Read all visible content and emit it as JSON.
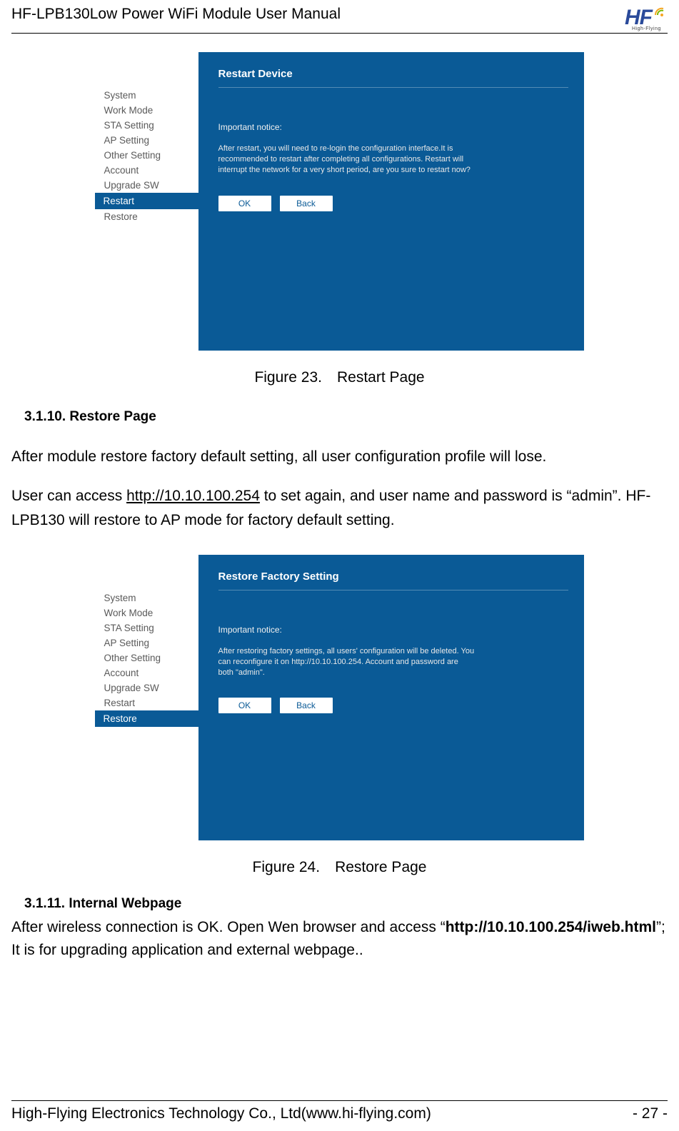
{
  "header": {
    "title": "HF-LPB130Low Power WiFi Module User Manual",
    "logo_text": "HF",
    "logo_sub": "High-Flying"
  },
  "fig23": {
    "sidebar": {
      "items": [
        {
          "label": "System"
        },
        {
          "label": "Work Mode"
        },
        {
          "label": "STA Setting"
        },
        {
          "label": "AP Setting"
        },
        {
          "label": "Other Setting"
        },
        {
          "label": "Account"
        },
        {
          "label": "Upgrade SW"
        },
        {
          "label": "Restart"
        },
        {
          "label": "Restore"
        }
      ],
      "active_index": 7
    },
    "panel": {
      "title": "Restart Device",
      "notice_label": "Important notice:",
      "notice_text": "After restart, you will need to re-login the configuration interface.It is recommended to restart after completing all configurations. Restart will interrupt the network for a very short period, are you sure to restart now?",
      "ok_label": "OK",
      "back_label": "Back"
    },
    "caption": "Figure 23. Restart Page"
  },
  "sec3110": {
    "heading": "3.1.10.  Restore Page",
    "para1": "After module restore factory default setting, all user configuration profile will lose.",
    "para2_pre": "User can access ",
    "para2_link": "http://10.10.100.254",
    "para2_post": " to set again, and user name and password is “admin”. HF-LPB130 will restore to AP mode for factory default setting."
  },
  "fig24": {
    "sidebar": {
      "items": [
        {
          "label": "System"
        },
        {
          "label": "Work Mode"
        },
        {
          "label": "STA Setting"
        },
        {
          "label": "AP Setting"
        },
        {
          "label": "Other Setting"
        },
        {
          "label": "Account"
        },
        {
          "label": "Upgrade SW"
        },
        {
          "label": "Restart"
        },
        {
          "label": "Restore"
        }
      ],
      "active_index": 8
    },
    "panel": {
      "title": "Restore Factory Setting",
      "notice_label": "Important notice:",
      "notice_text": "After restoring factory settings, all users' configuration will be deleted. You can reconfigure it on http://10.10.100.254. Account and password are both \"admin\".",
      "ok_label": "OK",
      "back_label": "Back"
    },
    "caption": "Figure 24. Restore Page"
  },
  "sec3111": {
    "heading": "3.1.11.  Internal Webpage",
    "para_pre": "After wireless connection is OK. Open Wen browser and access “",
    "para_bold": "http://10.10.100.254/iweb.html",
    "para_post": "”; It is for upgrading application and external webpage.."
  },
  "footer": {
    "left": "High-Flying Electronics Technology Co., Ltd(www.hi-flying.com)",
    "right": "- 27 -"
  }
}
